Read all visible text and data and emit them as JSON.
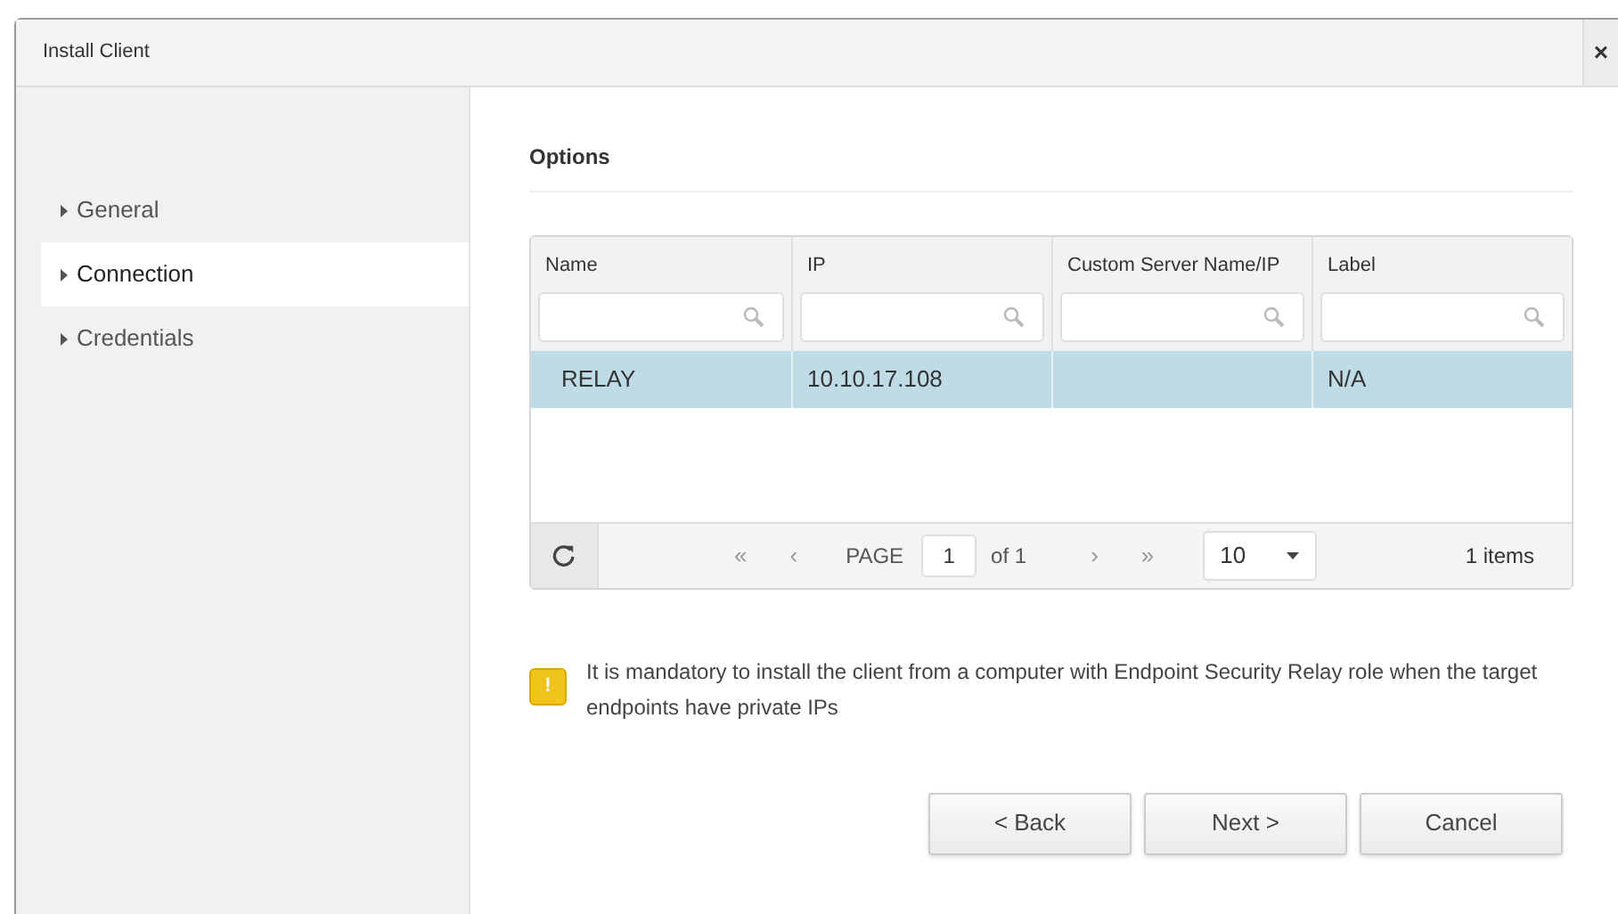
{
  "window": {
    "title": "Install Client",
    "close": "×"
  },
  "sidebar": {
    "items": [
      {
        "label": "General",
        "selected": false
      },
      {
        "label": "Connection",
        "selected": true
      },
      {
        "label": "Credentials",
        "selected": false
      }
    ]
  },
  "section_title": "Options",
  "table": {
    "columns": [
      "Name",
      "IP",
      "Custom Server Name/IP",
      "Label"
    ],
    "rows": [
      {
        "cells": [
          "RELAY",
          "10.10.17.108",
          "",
          "N/A"
        ],
        "selected": true
      }
    ]
  },
  "pager": {
    "first": "«",
    "prev": "‹",
    "page_label": "PAGE",
    "page": "1",
    "of": "of 1",
    "next": "›",
    "last": "»",
    "page_size": "10",
    "count": "1 items"
  },
  "warning": {
    "icon": "!",
    "text": "It is mandatory to install the client from a computer with Endpoint Security Relay role when the target endpoints have private IPs"
  },
  "buttons": [
    "< Back",
    "Next >",
    "Cancel"
  ]
}
